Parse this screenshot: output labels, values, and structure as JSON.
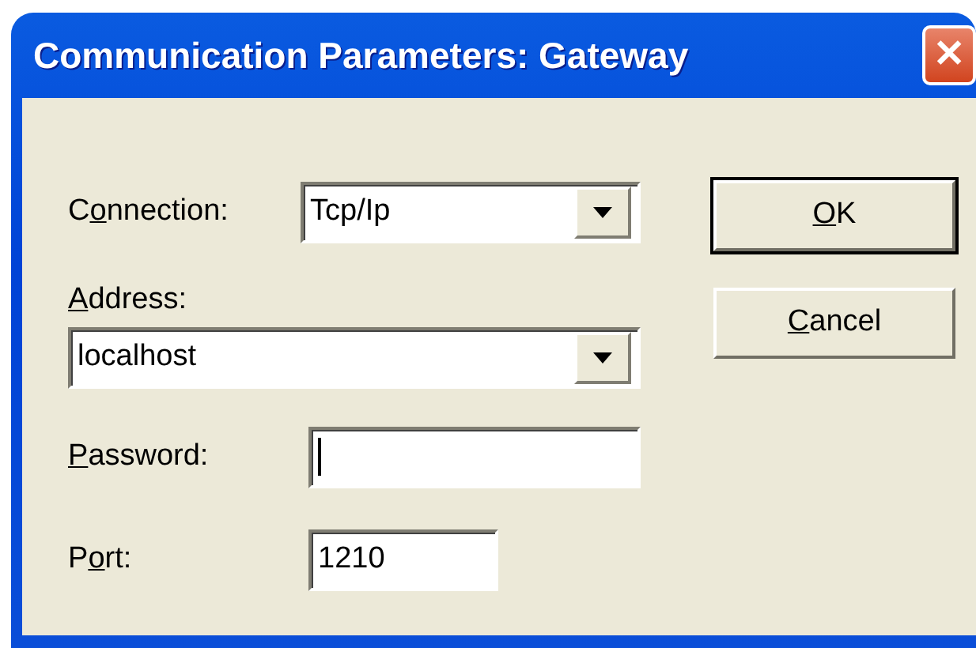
{
  "window": {
    "title": "Communication Parameters: Gateway",
    "close_label": "✕"
  },
  "fields": [
    {
      "kind": "combo",
      "label": {
        "before": "C",
        "key": "o",
        "after": "nnection:"
      },
      "value": "Tcp/Ip",
      "focused": false
    },
    {
      "kind": "combo-wide",
      "label": {
        "key": "A",
        "after": "ddress:"
      },
      "value": "localhost",
      "focused": false
    },
    {
      "kind": "text",
      "label": {
        "key": "P",
        "after": "assword:"
      },
      "focused": true
    },
    {
      "kind": "short",
      "label": {
        "before": "P",
        "key": "o",
        "after": "rt:"
      },
      "value": "1210",
      "focused": false
    }
  ],
  "buttons": [
    {
      "label": {
        "key": "O",
        "after": "K"
      },
      "default": true
    },
    {
      "label": {
        "key": "C",
        "after": "ancel"
      },
      "default": false
    }
  ]
}
